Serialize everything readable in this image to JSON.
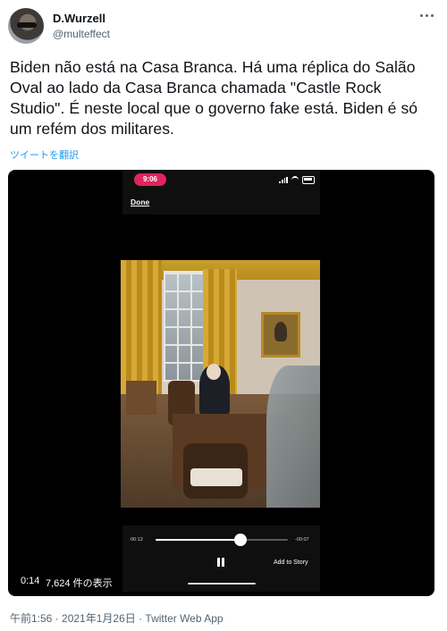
{
  "author": {
    "name": "D.Wurzell",
    "handle": "@multeffect"
  },
  "tweet": {
    "text": "Biden não está na Casa Branca. Há uma réplica do Salão Oval ao lado da Casa Branca chamada \"Castle Rock Studio\". É neste local que o governo fake está. Biden é só um refém dos militares.",
    "translate_label": "ツイートを翻訳"
  },
  "video": {
    "status_time": "9:06",
    "done_label": "Done",
    "elapsed_small": "00:12",
    "remaining_small": "-00:07",
    "progress": 0.64,
    "add_to_story": "Add to Story",
    "overlay_time": "0:14",
    "views": "7,624 件の表示"
  },
  "meta": {
    "timestamp": "午前1:56 · 2021年1月26日 · Twitter Web App"
  },
  "icons": {
    "more": "more-icon",
    "pause": "pause-icon"
  }
}
